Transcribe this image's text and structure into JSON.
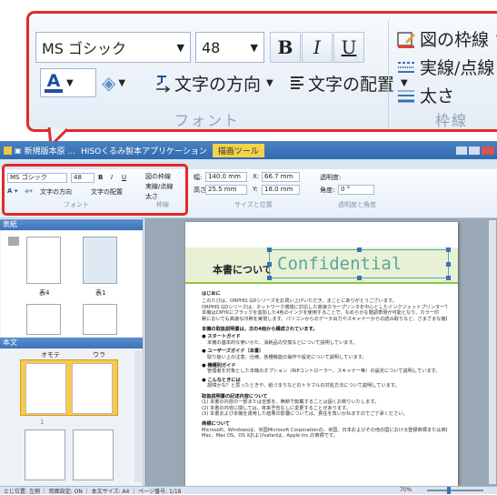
{
  "zoom": {
    "font_name": "MS ゴシック",
    "font_size": "48",
    "bold": "B",
    "italic": "I",
    "underline": "U",
    "font_color_letter": "A",
    "text_direction": "文字の方向",
    "text_align": "文字の配置",
    "group_font": "フォント",
    "border_label": "図の枠線",
    "dash_label": "実線/点線",
    "weight_label": "太さ",
    "group_border": "枠線"
  },
  "window": {
    "title_tab1": "新規版本原 ...",
    "title_tab2": "HISOくるみ製本アプリケーション",
    "context_tab": "描画ツール"
  },
  "ribbon": {
    "font_name": "MS ゴシック",
    "font_size": "48",
    "bold": "B",
    "italic": "I",
    "underline": "U",
    "text_direction": "文字の方向",
    "text_align": "文字の配置",
    "group_font": "フォント",
    "border_label": "図の枠線",
    "dash_label": "実線/点線",
    "weight_label": "太さ",
    "group_border": "枠線",
    "width_label": "幅:",
    "width_value": "140.0 mm",
    "height_label": "高さ:",
    "height_value": "25.5 mm",
    "x_label": "X:",
    "x_value": "66.7 mm",
    "y_label": "Y:",
    "y_value": "18.0 mm",
    "group_size": "サイズと位置",
    "transparency_label": "透明度:",
    "angle_label": "角度:",
    "angle_value": "0 °",
    "group_transparency": "透明度と角度"
  },
  "pane": {
    "section_cover": "表紙",
    "section_body": "本文",
    "cover_thumb1": "表4",
    "cover_thumb2": "表1",
    "col_front": "オモテ",
    "col_back": "ウラ",
    "page_number": "1"
  },
  "document": {
    "heading": "本書について",
    "watermark": "Confidential",
    "intro_title": "はじめに",
    "intro_lines": [
      "このたびは、ORPHIS GDシリーズをお買い上げいただき、まことにありがとうございます。",
      "ORPHIS GDシリーズは、ネットワーク環境に対応した高速カラープリンタを中心としたインクジェットプリンターです。",
      "本機はCMYKにブラックを追加した4色のインクを使用することで、なめらかな階調表現が可能となり、カラー印",
      "刷においても高速な印刷を実現します。パソコンからのデータ出力やスキャナーからの読み取りなど、さまざまな機能をご利用いただけます。"
    ],
    "manual_title": "本機の取扱説明書は、次の4冊から構成されています。",
    "manuals": [
      {
        "title": "● スタートガイド",
        "desc": "本機の基本的な使いかた、消耗品の交換などについて説明しています。"
      },
      {
        "title": "● ユーザーズガイド（本書）",
        "desc": "取り扱い上の注意、仕様、各種機能の操作や設定について説明しています。"
      },
      {
        "title": "● 機種別ガイド",
        "desc": "管理者を対象とした本機のオプション（RIPコントローラー、スキャナー等）の設定について説明しています。"
      },
      {
        "title": "● こんなときには",
        "desc": "故障かな？と思ったときや、紙づまりなどのトラブルの対処方法について説明しています。"
      }
    ],
    "notes_title": "取扱説明書の記述内容について",
    "notes": [
      "(1) 本書の内容の一部または全部を、無断で転載することは固くお断りいたします。",
      "(2) 本書の内容に関しては、将来予告なしに変更することがあります。",
      "(3) 本書および本機を運用した結果の影響については、責任を負いかねますのでご了承ください。"
    ],
    "trademark_title": "商標について",
    "trademarks": [
      "Microsoft、Windowsは、米国Microsoft Corporationの、米国、日本およびその他の国における登録商標または商標です。",
      "Mac、Mac OS、OS Xおよびsafariは、Apple Inc.の商標です。"
    ]
  },
  "status": {
    "text": "とじ位置: 左側 ｜ 両面設定: ON ｜ 本文サイズ: A4 ｜ ページ番号: 1/18",
    "zoom": "70%"
  },
  "colors": {
    "highlight_red": "#e22a26",
    "titlebar_blue": "#3a74b8",
    "heading_green": "#8cc63f",
    "watermark_teal": "#5aa79d",
    "selected_thumb": "#f7c94f"
  }
}
